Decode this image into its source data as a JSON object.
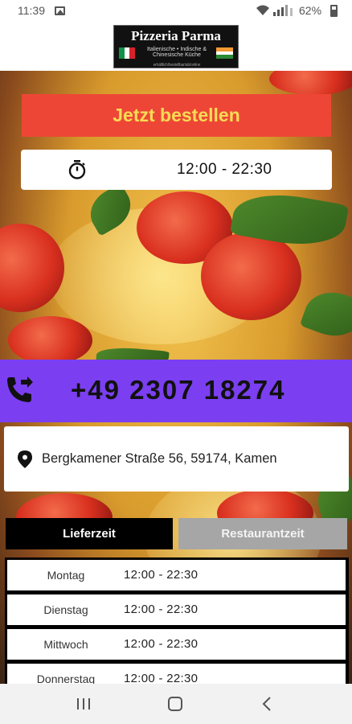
{
  "status_bar": {
    "time": "11:39",
    "battery": "62%",
    "icons": [
      "image-icon",
      "wifi-icon",
      "signal-icon",
      "battery-icon"
    ]
  },
  "header": {
    "logo_name": "Pizzeria Parma",
    "logo_tagline": "Italienische • Indische & Chinesische Küche",
    "logo_subtag": "erhältlich/bestellbar/ab/online"
  },
  "order_button": {
    "label": "Jetzt bestellen"
  },
  "hours": {
    "icon": "timer-icon",
    "text": "12:00 - 22:30"
  },
  "phone": {
    "icon": "phone-forward-icon",
    "number": "+49 2307 18274"
  },
  "address": {
    "icon": "location-pin-icon",
    "text": "Bergkamener Straße 56, 59174, Kamen"
  },
  "tabs": {
    "delivery": "Lieferzeit",
    "restaurant": "Restaurantzeit",
    "active": "delivery"
  },
  "schedule": [
    {
      "day": "Montag",
      "time": "12:00 - 22:30"
    },
    {
      "day": "Dienstag",
      "time": "12:00 - 22:30"
    },
    {
      "day": "Mittwoch",
      "time": "12:00 - 22:30"
    },
    {
      "day": "Donnerstag",
      "time": "12:00 - 22:30"
    }
  ],
  "colors": {
    "order_button_bg": "#ee4636",
    "order_button_text": "#f6dc54",
    "phone_bar_bg": "#7b3ff1",
    "active_tab_bg": "#000000",
    "inactive_tab_bg": "#a6a6a6"
  }
}
